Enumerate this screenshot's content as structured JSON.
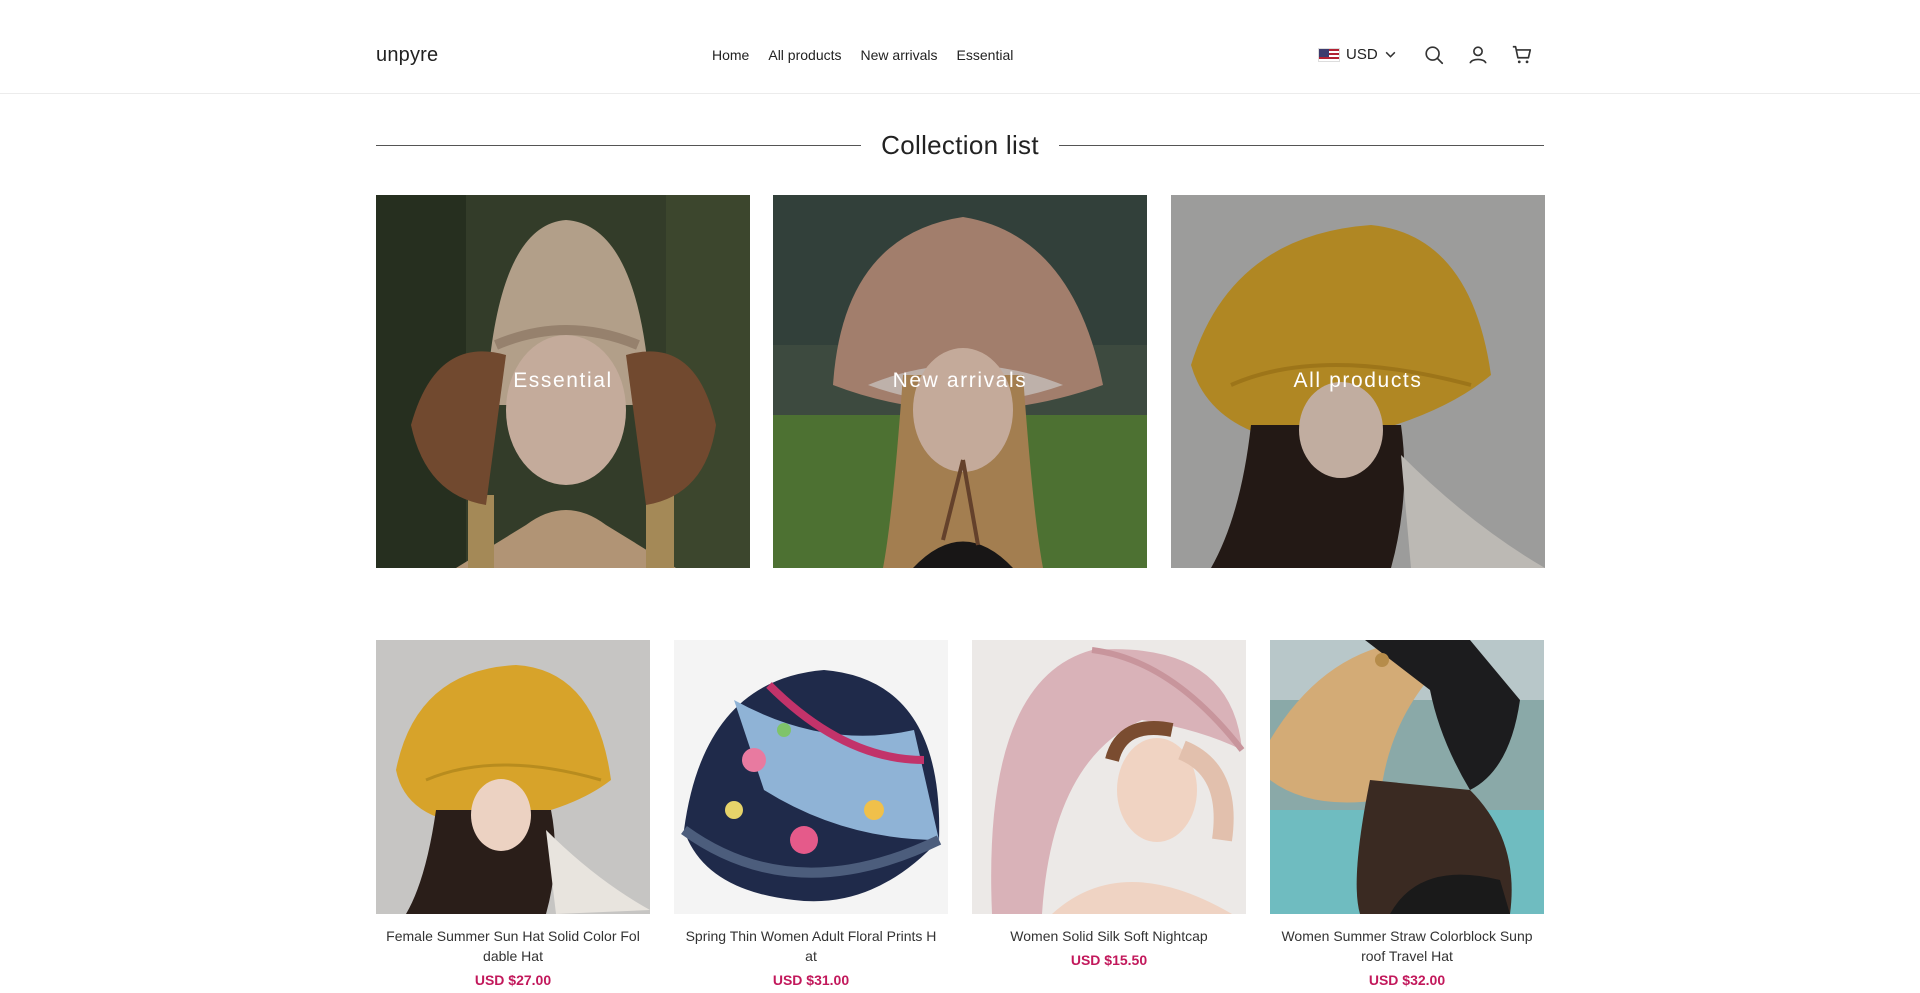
{
  "header": {
    "logo": "unpyre",
    "nav": [
      "Home",
      "All products",
      "New arrivals",
      "Essential"
    ],
    "currency": "USD"
  },
  "section": {
    "title": "Collection list"
  },
  "collections": [
    {
      "label": "Essential"
    },
    {
      "label": "New arrivals"
    },
    {
      "label": "All products"
    }
  ],
  "products": [
    {
      "title": "Female Summer Sun Hat Solid Color Fol dable Hat",
      "price": "USD $27.00"
    },
    {
      "title": "Spring Thin Women Adult Floral Prints H at",
      "price": "USD $31.00"
    },
    {
      "title": "Women Solid Silk Soft Nightcap",
      "price": "USD $15.50"
    },
    {
      "title": "Women Summer Straw Colorblock Sunp roof Travel Hat",
      "price": "USD $32.00"
    }
  ],
  "icons": [
    "search-icon",
    "account-icon",
    "cart-icon",
    "chevron-down-icon",
    "us-flag-icon"
  ],
  "colors": {
    "price": "#c2185b",
    "text": "#222222"
  }
}
